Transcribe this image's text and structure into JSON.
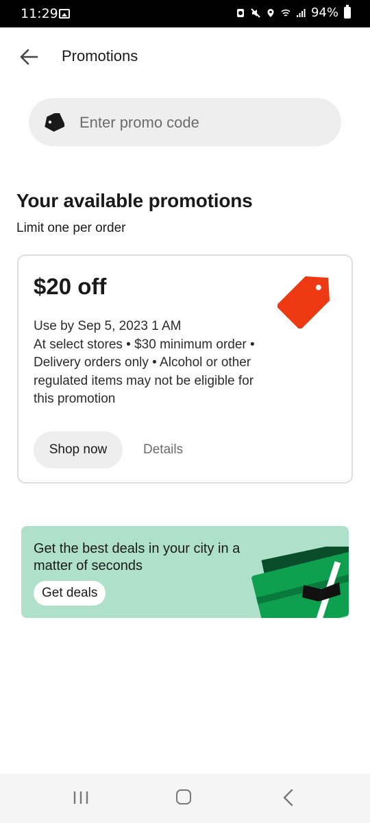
{
  "status_bar": {
    "time": "11:29",
    "battery": "94%"
  },
  "header": {
    "title": "Promotions"
  },
  "promo_input": {
    "placeholder": "Enter promo code",
    "value": ""
  },
  "section": {
    "title": "Your available promotions",
    "subtitle": "Limit one per order"
  },
  "promotion_card": {
    "amount": "$20 off",
    "details_lines": [
      "Use by Sep 5, 2023 1 AM",
      "At select stores • $30 minimum order •",
      "Delivery orders only • Alcohol or other",
      "regulated items may not be eligible for",
      "this promotion"
    ],
    "primary_button": "Shop now",
    "secondary_link": "Details",
    "tag_color": "#EE3A12"
  },
  "deals_banner": {
    "headline": "Get the best deals in your city in a matter of seconds",
    "button_label": "Get deals",
    "background_color": "#AFE0C9",
    "card_color": "#0E9F4F"
  },
  "icons": {
    "back": "arrow-left-icon",
    "promo": "tag-icon",
    "nav_recents": "recents-icon",
    "nav_home": "home-icon",
    "nav_back": "chevron-left-icon"
  }
}
